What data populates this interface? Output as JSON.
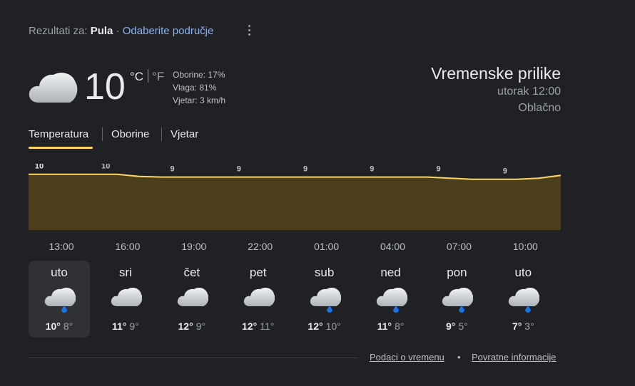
{
  "header": {
    "results_label": "Rezultati za:",
    "location": "Pula",
    "separator": "·",
    "change_area": "Odaberite područje"
  },
  "current": {
    "icon": "cloud-icon",
    "temperature": "10",
    "unit_c": "°C",
    "unit_f": "°F",
    "precipitation": "Oborine: 17%",
    "humidity": "Vlaga: 81%",
    "wind": "Vjetar: 3 km/h"
  },
  "info": {
    "title": "Vremenske prilike",
    "time": "utorak 12:00",
    "condition": "Oblačno"
  },
  "tabs": [
    "Temperatura",
    "Oborine",
    "Vjetar"
  ],
  "active_tab": 0,
  "colors": {
    "accent": "#fdd663",
    "area_fill": "#4a3f1a",
    "rain": "#1a73e8"
  },
  "chart_data": {
    "type": "area",
    "x": [
      "12:00",
      "13:00",
      "14:00",
      "15:00",
      "16:00",
      "17:00",
      "18:00",
      "19:00",
      "20:00",
      "21:00",
      "22:00",
      "23:00",
      "00:00",
      "01:00",
      "02:00",
      "03:00",
      "04:00",
      "05:00",
      "06:00",
      "07:00",
      "08:00",
      "09:00",
      "10:00",
      "11:00",
      "12:00"
    ],
    "y": [
      10,
      10,
      10,
      10,
      10,
      9.6,
      9.5,
      9.5,
      9.5,
      9.5,
      9.5,
      9.5,
      9.5,
      9.5,
      9.5,
      9.5,
      9.5,
      9.5,
      9.5,
      9.3,
      9.1,
      9.1,
      9.1,
      9.3,
      9.8
    ],
    "labels": [
      {
        "x": "12:00",
        "value": "10",
        "bold": true
      },
      {
        "x": "15:00",
        "value": "10"
      },
      {
        "x": "18:00",
        "value": "9"
      },
      {
        "x": "21:00",
        "value": "9"
      },
      {
        "x": "00:00",
        "value": "9"
      },
      {
        "x": "03:00",
        "value": "9"
      },
      {
        "x": "06:00",
        "value": "9"
      },
      {
        "x": "09:00",
        "value": "9"
      }
    ],
    "xticks": [
      "13:00",
      "16:00",
      "19:00",
      "22:00",
      "01:00",
      "04:00",
      "07:00",
      "10:00"
    ],
    "ylim": [
      0,
      10.6
    ]
  },
  "days": [
    {
      "name": "uto",
      "icon": "cloud-rain-icon",
      "high": "10°",
      "low": "8°",
      "selected": true
    },
    {
      "name": "sri",
      "icon": "cloud-icon",
      "high": "11°",
      "low": "9°"
    },
    {
      "name": "čet",
      "icon": "cloud-icon",
      "high": "12°",
      "low": "9°"
    },
    {
      "name": "pet",
      "icon": "cloud-icon",
      "high": "12°",
      "low": "11°"
    },
    {
      "name": "sub",
      "icon": "cloud-rain-icon",
      "high": "12°",
      "low": "10°"
    },
    {
      "name": "ned",
      "icon": "cloud-rain-icon",
      "high": "11°",
      "low": "8°"
    },
    {
      "name": "pon",
      "icon": "cloud-rain-icon",
      "high": "9°",
      "low": "5°"
    },
    {
      "name": "uto",
      "icon": "cloud-rain-icon",
      "high": "7°",
      "low": "3°"
    }
  ],
  "footer": {
    "weather_data": "Podaci o vremenu",
    "dot": "•",
    "feedback": "Povratne informacije"
  }
}
